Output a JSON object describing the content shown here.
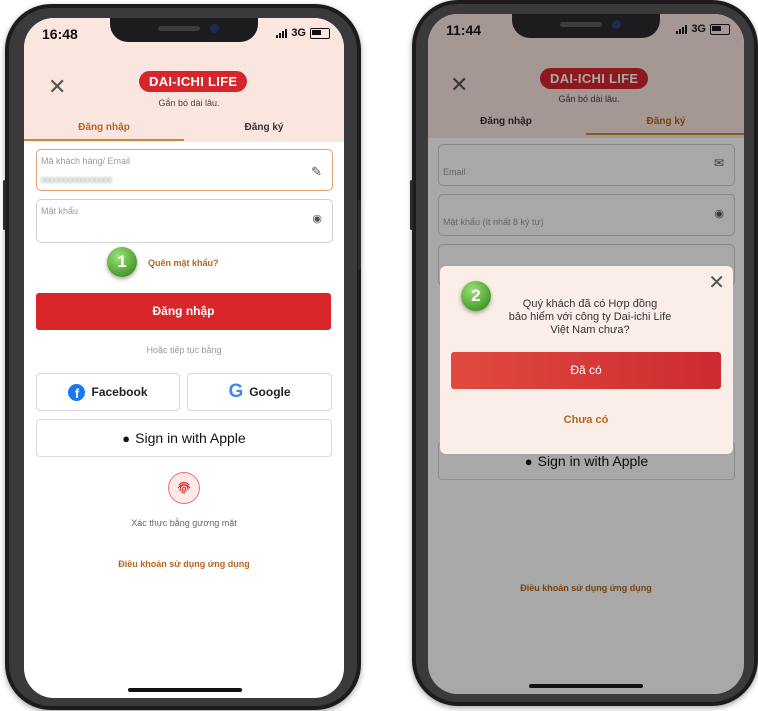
{
  "phone1": {
    "time": "16:48",
    "network": "3G",
    "logo": "DAI-ICHI LIFE",
    "slogan": "Gắn bó dài lâu.",
    "tabs": [
      "Đăng nhập",
      "Đăng ký"
    ],
    "fields": {
      "id_label": "Mã khách hàng/ Email",
      "id_value": "0000000000000000",
      "password_label": "Mật khẩu"
    },
    "forgot_password": "Quên mật khẩu?",
    "login_button": "Đăng nhập",
    "continue_with": "Hoặc tiếp tục bằng",
    "facebook": "Facebook",
    "google": "Google",
    "apple": "Sign in with Apple",
    "face_id": "Xác thực bằng gương mặt",
    "terms": "Điều khoản sử dụng ứng dụng",
    "step_badge": "1"
  },
  "phone2": {
    "time": "11:44",
    "network": "3G",
    "logo": "DAI-ICHI LIFE",
    "slogan": "Gắn bó dài lâu.",
    "tabs": [
      "Đăng nhập",
      "Đăng ký"
    ],
    "fields": {
      "email_label": "Email",
      "password_label": "Mật khẩu (ít nhất 8 ký tự)"
    },
    "modal": {
      "question_lines": [
        "Quý khách đã có Hợp đồng",
        "bảo hiểm với công ty Dai-ichi Life",
        "Việt Nam chưa?"
      ],
      "yes_button": "Đã có",
      "no_button": "Chưa có"
    },
    "apple": "Sign in with Apple",
    "terms": "Điều khoản sử dụng ứng dụng",
    "step_badge": "2"
  },
  "colors": {
    "brand_red": "#d9262b",
    "link_brown": "#b5651d",
    "header_bg": "#fbe5df",
    "badge_green": "#4c9c2d"
  },
  "icons": [
    "close-icon",
    "edit-pencil-icon",
    "eye-icon",
    "facebook-icon",
    "google-icon",
    "apple-icon",
    "fingerprint-icon",
    "mail-icon"
  ]
}
